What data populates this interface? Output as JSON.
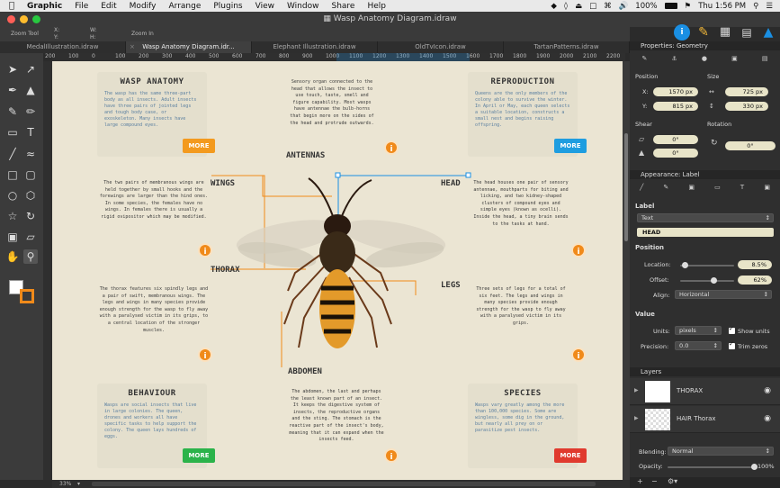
{
  "menubar": {
    "app": "Graphic",
    "items": [
      "File",
      "Edit",
      "Modify",
      "Arrange",
      "Plugins",
      "View",
      "Window",
      "Share",
      "Help"
    ],
    "battery": "100%",
    "clock": "Thu 1:56 PM"
  },
  "window": {
    "title": "Wasp Anatomy Diagram.idraw"
  },
  "toolinfo": {
    "tool_label": "Zoom Tool",
    "x_label": "X:",
    "y_label": "Y:",
    "w_label": "W:",
    "h_label": "H:",
    "action": "Zoom In"
  },
  "tabs": [
    "MedalIllustration.idraw",
    "Wasp Anatomy Diagram.idr...",
    "Elephant Illustration.idraw",
    "OldTvIcon.idraw",
    "TartanPatterns.idraw"
  ],
  "ruler_ticks": [
    "200",
    "100",
    "0",
    "100",
    "200",
    "300",
    "400",
    "500",
    "600",
    "700",
    "800",
    "900",
    "1000",
    "1100",
    "1200",
    "1300",
    "1400",
    "1500",
    "1600",
    "1700",
    "1800",
    "1900",
    "2000",
    "2100",
    "2200",
    "2300"
  ],
  "diagram": {
    "cards": {
      "wasp_anatomy": {
        "title": "WASP ANATOMY",
        "text": "The wasp has the same three-part body as all insects. Adult insects have three pairs of jointed legs and tough body case, or exoskeleton. Many insects have large compound eyes."
      },
      "reproduction": {
        "title": "REPRODUCTION",
        "text": "Queens are the only members of the colony able to survive the winter. In April or May, each queen selects a suitable location, constructs a small nest and begins raising offspring."
      },
      "behaviour": {
        "title": "BEHAVIOUR",
        "text": "Wasps are social insects that live in large colonies. The queen, drones and workers all have specific tasks to help support the colony. The queen lays hundreds of eggs."
      },
      "species": {
        "title": "SPECIES",
        "text": "Wasps vary greatly among the more than 100,000 species. Some are wingless, some dig in the ground, but nearly all prey on or parasitize pest insects."
      }
    },
    "more_label": "MORE",
    "info_glyph": "i",
    "labels": {
      "antennas": "ANTENNAS",
      "wings": "WINGS",
      "head": "HEAD",
      "thorax": "THORAX",
      "legs": "LEGS",
      "abdomen": "ABDOMEN"
    },
    "texts": {
      "antennas": "Sensory organ connected to the head that allows the insect to use touch, taste, smell and figure capability. Most wasps have antennae the bulb-horns that begin more on the sides of the head and protrude outwards.",
      "wings": "The two pairs of membranous wings are held together by small hooks and the forewings are larger than the hind ones. In some species, the females have no wings. In females there is usually a rigid ovipositor which may be modified.",
      "head": "The head houses one pair of sensory antennae, mouthparts for biting and licking, and two kidney-shaped clusters of compound eyes and simple eyes (known as ocelli). Inside the head, a tiny brain sends to the tasks at hand.",
      "thorax": "The thorax features six spindly legs and a pair of swift, membranous wings. The legs and wings in many species provide enough strength for the wasp to fly away with a paralysed victim in its grips, to a central location of the stronger muscles.",
      "legs": "Three sets of legs for a total of six feet. The legs and wings in many species provide enough strength for the wasp to fly away with a paralysed victim in its grips.",
      "abdomen": "The abdomen, the last and perhaps the least known part of an insect. It keeps the digestive system of insects, the reproductive organs and the sting. The stomach is the reactive part of the insect's body, meaning that it can expand when the insects feed."
    }
  },
  "panel": {
    "tab_title": "Properties: Geometry",
    "position_label": "Position",
    "size_label": "Size",
    "x_label": "X:",
    "y_label": "Y:",
    "x_value": "1570 px",
    "y_value": "815 px",
    "w_value": "725 px",
    "h_value": "330 px",
    "shear_label": "Shear",
    "rotation_label": "Rotation",
    "shear_h": "0°",
    "shear_v": "0°",
    "rotation_value": "0°",
    "appearance_title": "Appearance: Label",
    "label_section": "Label",
    "label_type": "Text",
    "label_text": "HEAD",
    "position_section": "Position",
    "location_label": "Location:",
    "location_value": "8.5%",
    "location_pct": 0.085,
    "offset_label": "Offset:",
    "offset_value": "62%",
    "offset_pct": 0.62,
    "align_label": "Align:",
    "align_value": "Horizontal",
    "value_section": "Value",
    "units_label": "Units:",
    "units_value": "pixels",
    "show_units": "Show units",
    "precision_label": "Precision:",
    "precision_value": "0.0",
    "trim_zeros": "Trim zeros",
    "layers_title": "Layers",
    "layers": [
      "THORAX",
      "HAIR Thorax"
    ],
    "blending_label": "Blending:",
    "blending_value": "Normal",
    "opacity_label": "Opacity:",
    "opacity_value": "100%",
    "opacity_pct": 1.0
  },
  "zoom": "33%",
  "colors": {
    "orange": "#f08a1a",
    "more_orange": "#f39a1e",
    "more_blue": "#1e9de0",
    "more_green": "#2bb34a",
    "more_red": "#e03a2e",
    "accent_blue": "#1a8fe3"
  }
}
